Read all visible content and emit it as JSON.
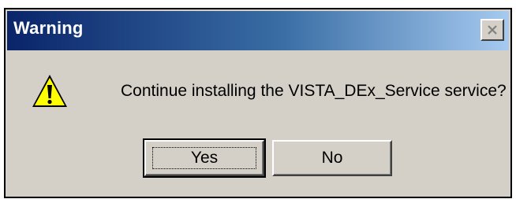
{
  "window": {
    "title": "Warning"
  },
  "dialog": {
    "message": "Continue installing the VISTA_DEx_Service service?",
    "icon": "warning-icon"
  },
  "buttons": {
    "yes_label": "Yes",
    "no_label": "No"
  },
  "colors": {
    "titlebar_start": "#0a246a",
    "titlebar_end": "#a6caf0",
    "dialog_bg": "#d4d0c8",
    "warning_yellow": "#ffff00"
  }
}
